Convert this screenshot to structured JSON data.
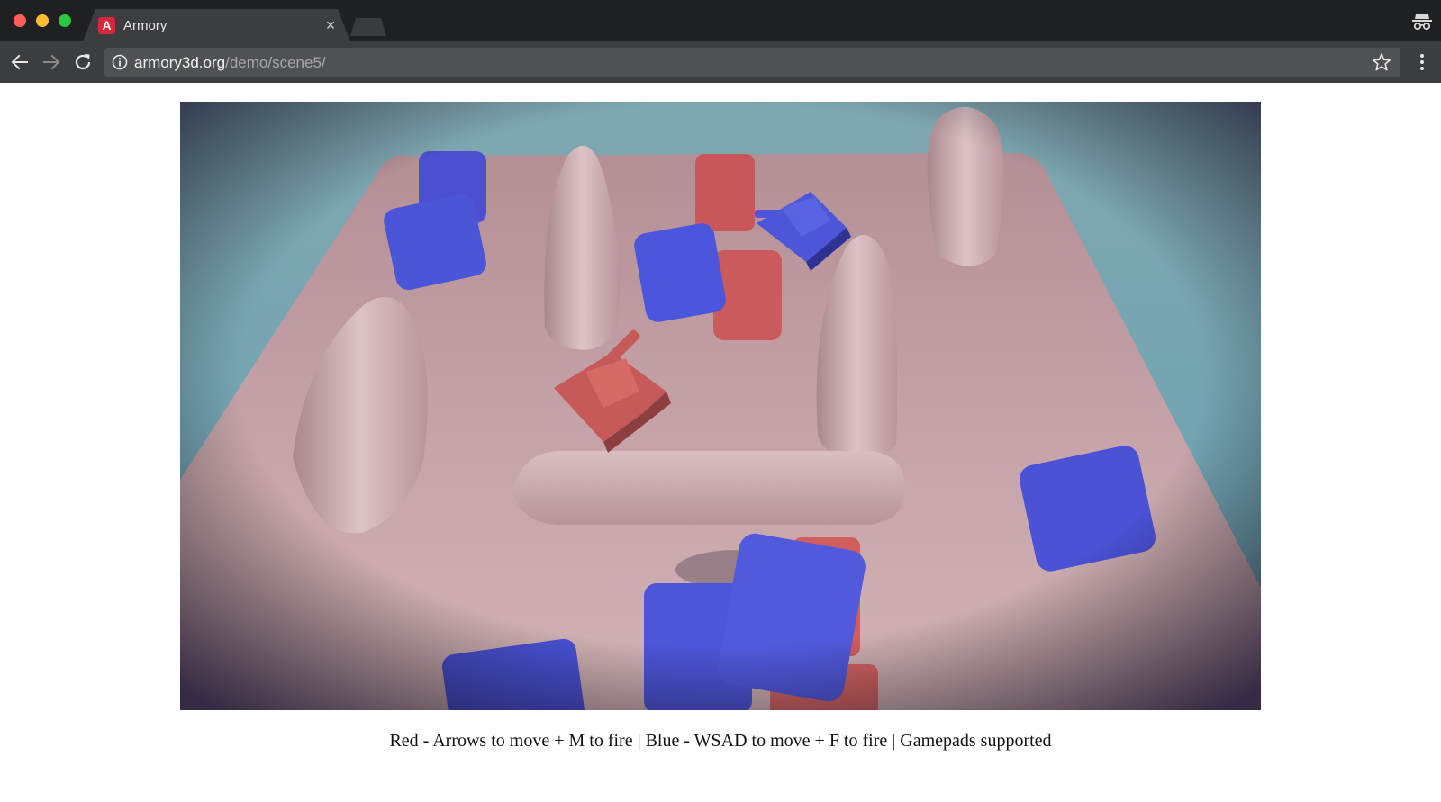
{
  "browser": {
    "tab": {
      "favicon_letter": "A",
      "title": "Armory",
      "close_glyph": "×"
    },
    "address_bar": {
      "url_host": "armory3d.org",
      "url_path": "/demo/scene5/"
    },
    "icons": [
      "back-icon",
      "forward-icon",
      "reload-icon",
      "info-icon",
      "star-icon",
      "menu-icon",
      "incognito-icon"
    ]
  },
  "page": {
    "caption": "Red - Arrows to move + M to fire | Blue - WSAD to move + F to fire | Gamepads supported"
  },
  "colors": {
    "sky": "#77a6b3",
    "ground": "#c9a7ab",
    "red_team": "#d0605e",
    "blue_team": "#4a53d4",
    "favicon": "#d6283b"
  }
}
